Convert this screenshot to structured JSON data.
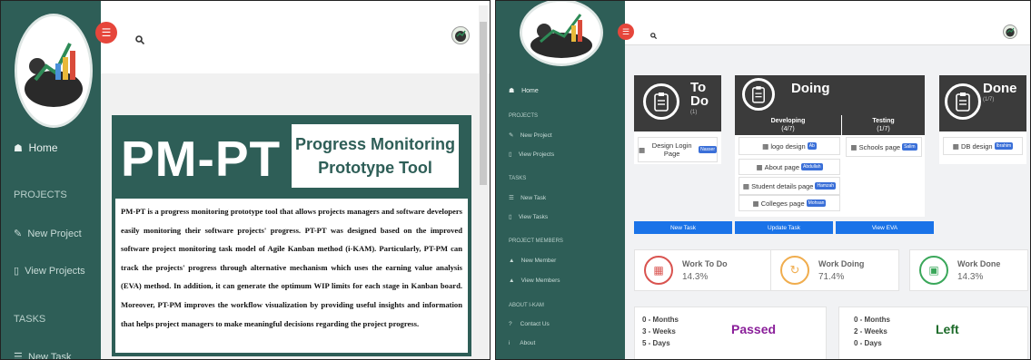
{
  "left": {
    "nav": {
      "home": "Home",
      "projects_header": "PROJECTS",
      "new_project": "New Project",
      "view_projects": "View Projects",
      "tasks_header": "TASKS",
      "new_task": "New Task"
    },
    "banner": {
      "title": "PM-PT",
      "subtitle": "Progress Monitoring Prototype Tool",
      "description": "PM-PT is a progress monitoring prototype tool that allows projects managers and software developers easily monitoring their software projects' progress. PT-PT was designed based on the improved software project monitoring task model of Agile Kanban method (i-KAM). Particularly, PT-PM can track the projects' progress through alternative mechanism which uses the earning value analysis (EVA) method. In addition, it can generate the optimum WIP limits for each stage in Kanban board. Moreover, PT-PM improves the workflow visualization by providing useful insights and information that helps project managers to make meaningful decisions regarding the project progress."
    }
  },
  "right": {
    "nav": {
      "home": "Home",
      "projects_header": "PROJECTS",
      "new_project": "New Project",
      "view_projects": "View Projects",
      "tasks_header": "TASKS",
      "new_task": "New Task",
      "view_tasks": "View Tasks",
      "members_header": "PROJECT MEMBERS",
      "new_member": "New Member",
      "view_members": "View Members",
      "about_header": "ABOUT I-KAM",
      "contact_us": "Contact Us",
      "about": "About"
    },
    "board": {
      "todo": {
        "title_line1": "To",
        "title_line2": "Do",
        "count": "(1)",
        "card": "Design Login Page",
        "tag": "Nasser"
      },
      "doing": {
        "title": "Doing",
        "developing": {
          "label": "Developing",
          "count": "(4/7)"
        },
        "testing": {
          "label": "Testing",
          "count": "(1/7)"
        },
        "cards": [
          {
            "text": "logo design",
            "tag": "Ab"
          },
          {
            "text": "About page",
            "tag": "Abdullah"
          },
          {
            "text": "Student details page",
            "tag": "Hamzah"
          },
          {
            "text": "Colleges page",
            "tag": "Mohsan"
          }
        ],
        "testing_card": {
          "text": "Schools page",
          "tag": "Salim"
        }
      },
      "done": {
        "title": "Done",
        "count": "(1/7)",
        "card": "DB design",
        "tag": "Ibrahim"
      }
    },
    "buttons": {
      "new_task": "New Task",
      "update_task": "Update Task",
      "view_eva": "View EVA"
    },
    "stats": [
      {
        "label": "Work To Do",
        "value": "14.3%",
        "color": "#d9534f"
      },
      {
        "label": "Work Doing",
        "value": "71.4%",
        "color": "#f0ad4e"
      },
      {
        "label": "Work Done",
        "value": "14.3%",
        "color": "#3aa75a"
      }
    ],
    "timeline": {
      "passed": {
        "months": "0 - Months",
        "weeks": "3 - Weeks",
        "days": "5 - Days",
        "label": "Passed",
        "color": "#8a1f9a"
      },
      "left": {
        "months": "0 - Months",
        "weeks": "2 - Weeks",
        "days": "0 - Days",
        "label": "Left",
        "color": "#1d6b2a"
      }
    }
  }
}
